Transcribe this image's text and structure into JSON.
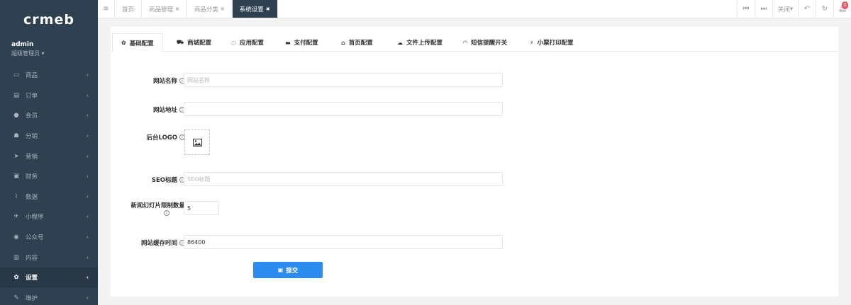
{
  "logo": "crmeb",
  "user": {
    "name": "admin",
    "role": "超级管理员"
  },
  "sidebar": {
    "items": [
      {
        "label": "商品",
        "icon": "laptop-icon",
        "glyph": "▭"
      },
      {
        "label": "订单",
        "icon": "list-icon",
        "glyph": "▤"
      },
      {
        "label": "会员",
        "icon": "user-icon",
        "glyph": "●"
      },
      {
        "label": "分销",
        "icon": "users-icon",
        "glyph": "☗"
      },
      {
        "label": "营销",
        "icon": "send-icon",
        "glyph": "➤"
      },
      {
        "label": "财务",
        "icon": "money-icon",
        "glyph": "▣"
      },
      {
        "label": "数据",
        "icon": "chart-icon",
        "glyph": "⌇"
      },
      {
        "label": "小程序",
        "icon": "rocket-icon",
        "glyph": "✈"
      },
      {
        "label": "公众号",
        "icon": "wechat-icon",
        "glyph": "◉"
      },
      {
        "label": "内容",
        "icon": "book-icon",
        "glyph": "▥"
      },
      {
        "label": "设置",
        "icon": "gear-icon",
        "glyph": "✿",
        "active": true
      },
      {
        "label": "维护",
        "icon": "wrench-icon",
        "glyph": "✎"
      }
    ]
  },
  "topbar": {
    "tabs": [
      {
        "label": "首页",
        "closable": false
      },
      {
        "label": "商品管理",
        "closable": true
      },
      {
        "label": "商品分类",
        "closable": true
      },
      {
        "label": "系统设置",
        "closable": true,
        "active": true
      }
    ],
    "close_label": "关闭",
    "notification_count": "0"
  },
  "config_tabs": [
    {
      "label": "基础配置",
      "icon": "gear-icon",
      "glyph": "✿",
      "active": true
    },
    {
      "label": "商城配置",
      "icon": "cart-icon",
      "glyph": "⛟"
    },
    {
      "label": "应用配置",
      "icon": "whatsapp-icon",
      "glyph": "◌"
    },
    {
      "label": "支付配置",
      "icon": "credit-card-icon",
      "glyph": "▬"
    },
    {
      "label": "首页配置",
      "icon": "home-icon",
      "glyph": "⌂"
    },
    {
      "label": "文件上传配置",
      "icon": "cloud-upload-icon",
      "glyph": "☁"
    },
    {
      "label": "短信提醒开关",
      "icon": "rss-icon",
      "glyph": "◠"
    },
    {
      "label": "小票打印配置",
      "icon": "plug-icon",
      "glyph": "⚡"
    }
  ],
  "form": {
    "site_name": {
      "label": "网站名称",
      "placeholder": "网站名称",
      "value": ""
    },
    "site_url": {
      "label": "网站地址",
      "placeholder": "",
      "value": ""
    },
    "admin_logo": {
      "label": "后台LOGO"
    },
    "seo_title": {
      "label": "SEO标题",
      "placeholder": "SEO标题",
      "value": ""
    },
    "news_slide_limit": {
      "label": "新闻幻灯片限制数量",
      "value": "5"
    },
    "cache_time": {
      "label": "网站缓存时间",
      "value": "86400"
    },
    "submit_label": "提交"
  },
  "colors": {
    "sidebar": "#2f4050",
    "active_tab": "#2f4050",
    "primary": "#2d8cf0",
    "badge": "#ed5565"
  }
}
